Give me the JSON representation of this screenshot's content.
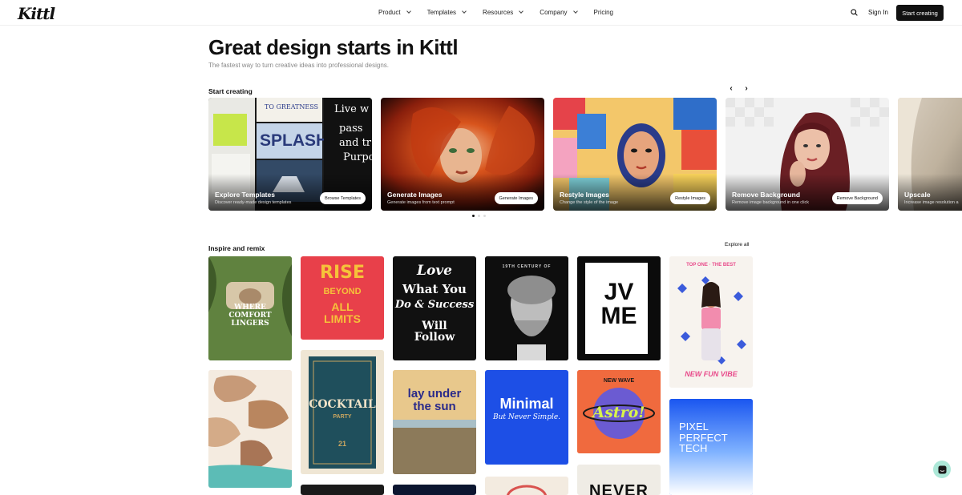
{
  "header": {
    "logo": "Kittl",
    "nav": [
      {
        "label": "Product",
        "has_dropdown": true
      },
      {
        "label": "Templates",
        "has_dropdown": true
      },
      {
        "label": "Resources",
        "has_dropdown": true
      },
      {
        "label": "Company",
        "has_dropdown": true
      },
      {
        "label": "Pricing",
        "has_dropdown": false
      }
    ],
    "search_icon": "search-icon",
    "sign_in": "Sign In",
    "start_creating": "Start creating"
  },
  "hero": {
    "title": "Great design starts in Kittl",
    "subtitle": "The fastest way to turn creative ideas into professional designs."
  },
  "start_section": {
    "title": "Start creating",
    "prev_icon": "chevron-left-icon",
    "next_icon": "chevron-right-icon",
    "cards": [
      {
        "title": "Explore Templates",
        "subtitle": "Discover ready-made design templates",
        "button": "Browse Templates"
      },
      {
        "title": "Generate Images",
        "subtitle": "Generate images from text prompt",
        "button": "Generate Images"
      },
      {
        "title": "Restyle Images",
        "subtitle": "Change the style of the image",
        "button": "Restyle Images"
      },
      {
        "title": "Remove Background",
        "subtitle": "Remove image background in one click",
        "button": "Remove Background"
      },
      {
        "title": "Upscale",
        "subtitle": "Increase image resolution a"
      }
    ],
    "pagination": {
      "pages": 3,
      "active": 1
    }
  },
  "inspire_section": {
    "title": "Inspire and remix",
    "explore_all": "Explore all",
    "tiles": {
      "where": "WHERE COMFORT LINGERS",
      "rise_1": "RISE",
      "rise_2": "BEYOND",
      "rise_3": "ALL LIMITS",
      "love_1": "Love",
      "love_2": "What You",
      "love_3": "Do & Success",
      "love_4": "Will Follow",
      "statue_top": "19TH CENTURY OF",
      "jvme": "JV ME",
      "pink_top": "TOP ONE · THE BEST",
      "pink_bottom": "NEW FUN VIBE",
      "cocktail": "COCKTAIL",
      "cocktail_sub": "PARTY",
      "cocktail_date": "21",
      "lay_under": "lay under the sun",
      "minimal_1": "Minimal",
      "minimal_2": "But Never Simple.",
      "astro_top": "NEW WAVE",
      "astro": "Astro!",
      "pixel": "PIXEL PERFECT TECH",
      "never": "NEVER"
    }
  },
  "chat_icon": "chat-icon"
}
